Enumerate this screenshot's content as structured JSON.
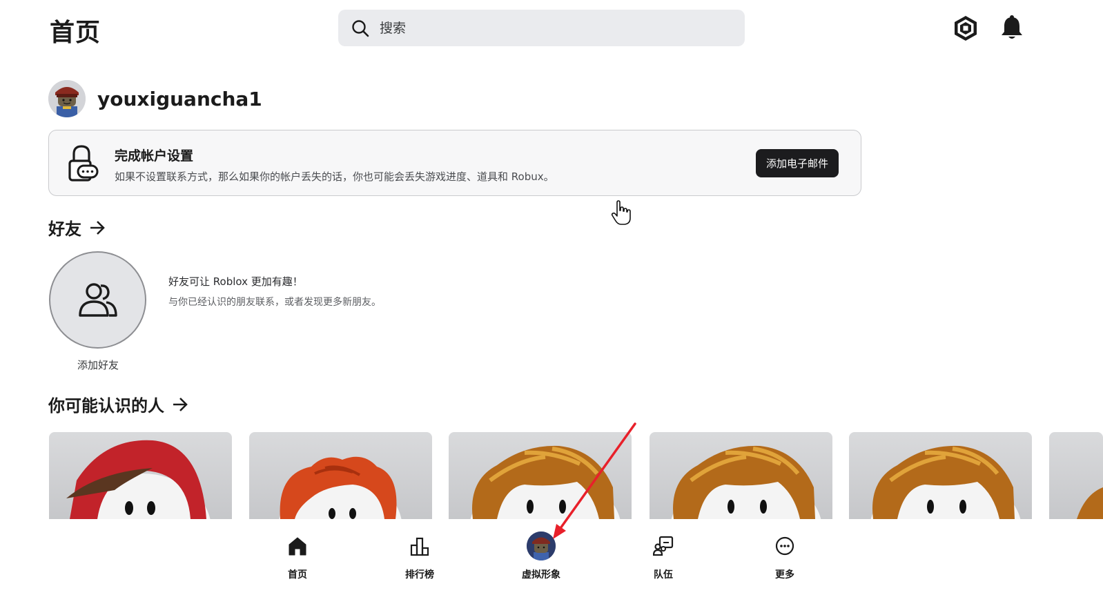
{
  "header": {
    "title": "首页",
    "search_placeholder": "搜索",
    "icons": [
      "search-icon",
      "robux-icon",
      "bell-icon"
    ]
  },
  "profile": {
    "username": "youxiguancha1"
  },
  "account_card": {
    "title": "完成帐户设置",
    "description": "如果不设置联系方式，那么如果你的帐户丢失的话，你也可能会丢失游戏进度、道具和 Robux。",
    "button_label": "添加电子邮件"
  },
  "friends": {
    "heading": "好友",
    "add_friend_label": "添加好友",
    "promo_title": "好友可让 Roblox 更加有趣！",
    "promo_description": "与你已经认识的朋友联系，或者发现更多新朋友。"
  },
  "people_you_may_know": {
    "heading": "你可能认识的人",
    "cards": [
      {
        "hair": "red-hood"
      },
      {
        "hair": "orange-curly"
      },
      {
        "hair": "brown-bacon"
      },
      {
        "hair": "brown-bacon"
      },
      {
        "hair": "brown-bacon"
      }
    ]
  },
  "bottom_nav": {
    "items": [
      {
        "label": "首页",
        "icon": "home-icon"
      },
      {
        "label": "排行榜",
        "icon": "chart-icon"
      },
      {
        "label": "虚拟形象",
        "icon": "avatar"
      },
      {
        "label": "队伍",
        "icon": "party-icon"
      },
      {
        "label": "更多",
        "icon": "more-icon"
      }
    ]
  },
  "colors": {
    "annotation_arrow": "#e8202a",
    "button_dark": "#1c1c1e",
    "search_bg": "#eaebee"
  }
}
